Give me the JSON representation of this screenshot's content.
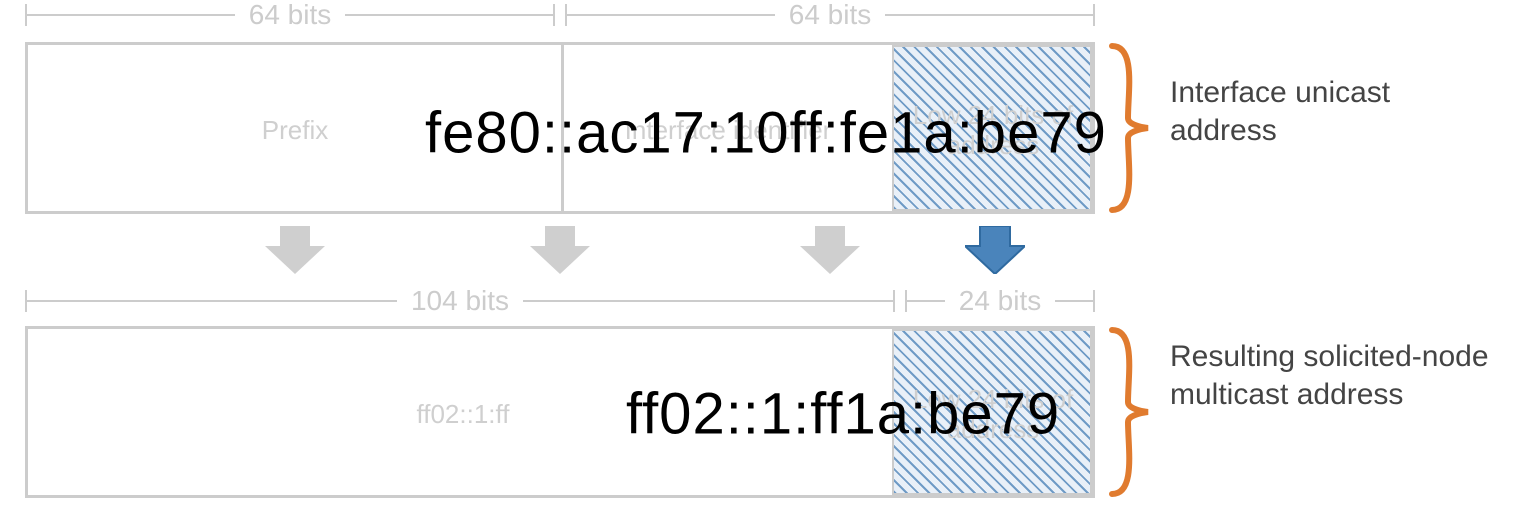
{
  "top_dims": {
    "left": "64 bits",
    "right": "64 bits"
  },
  "bottom_dims": {
    "left": "104 bits",
    "right": "24 bits"
  },
  "upper_box": {
    "prefix_ghost": "Prefix",
    "iid_ghost": "Interface identifier",
    "low24_ghost": "Low 24 bits of address"
  },
  "lower_box": {
    "prefix_ghost": "ff02::1:ff",
    "low24_ghost": "Low 24 bits of address"
  },
  "addresses": {
    "unicast": "fe80::ac17:10ff:fe1a:be79",
    "solicited": "ff02::1:ff1a:be79"
  },
  "captions": {
    "upper": "Interface unicast address",
    "lower": "Resulting solicited-node multicast address"
  },
  "colors": {
    "brace": "#e07b2f",
    "arrow_blue": "#4a84bb",
    "arrow_grey": "#cfcfcf"
  }
}
